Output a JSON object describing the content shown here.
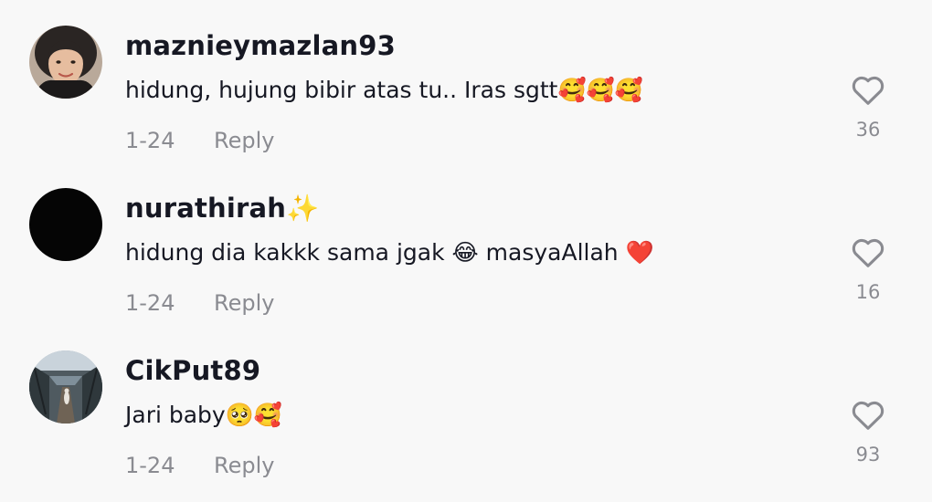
{
  "comments": [
    {
      "username": "maznieymazlan93",
      "text": "hidung, hujung bibir atas tu.. Iras sgtt🥰🥰🥰",
      "date": "1-24",
      "reply_label": "Reply",
      "likes": "36",
      "avatar_icon": "profile-photo-woman-hijab"
    },
    {
      "username": "nurathirah✨",
      "text": "hidung dia kakkk sama jgak 😂 masyaAllah ❤️",
      "date": "1-24",
      "reply_label": "Reply",
      "likes": "16",
      "avatar_icon": "profile-photo-black"
    },
    {
      "username": "CikPut89",
      "text": "Jari baby🥺🥰",
      "date": "1-24",
      "reply_label": "Reply",
      "likes": "93",
      "avatar_icon": "profile-photo-bridge"
    }
  ],
  "colors": {
    "background": "#f8f8f8",
    "username": "#161823",
    "meta": "#8a8b91",
    "heart_outline": "#8a8b91"
  }
}
